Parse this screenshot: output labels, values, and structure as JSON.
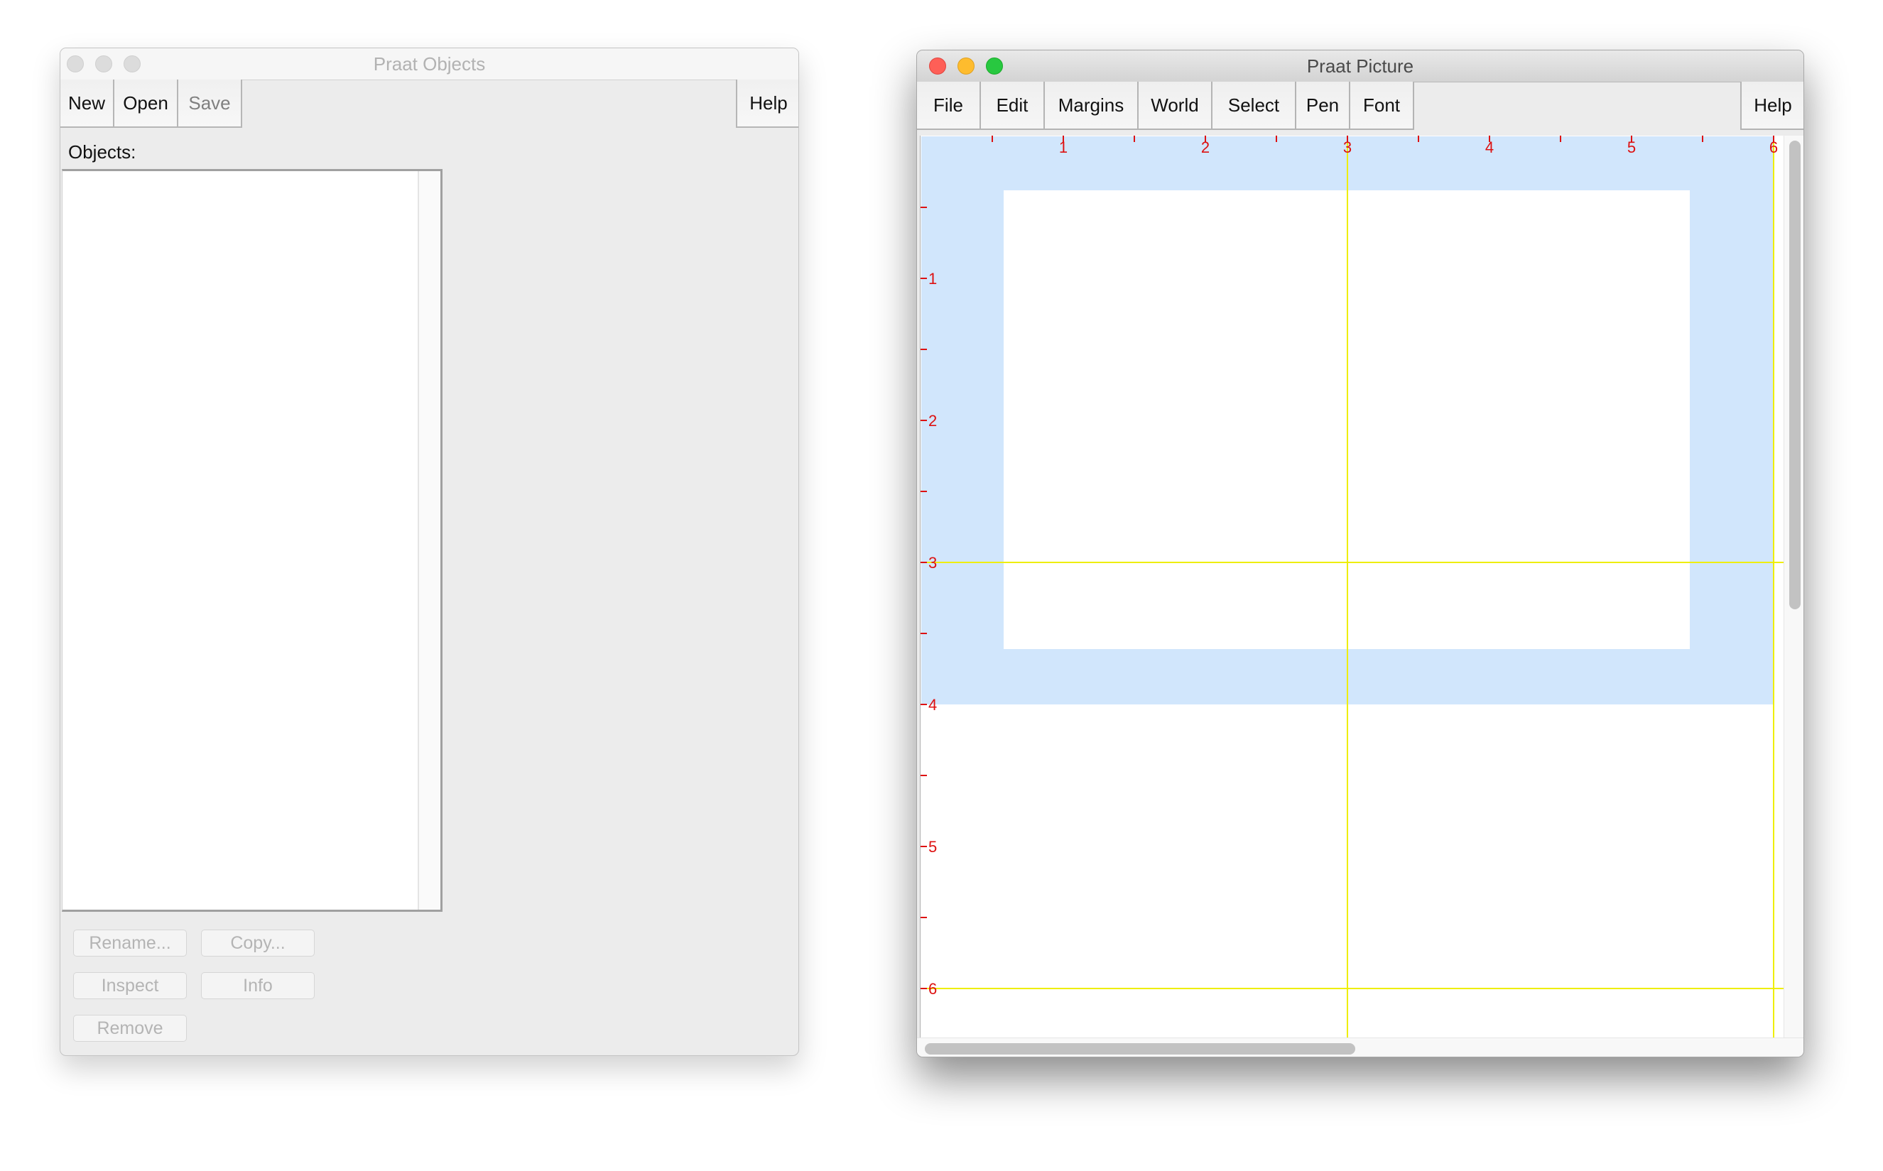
{
  "objects_window": {
    "title": "Praat Objects",
    "active": false,
    "toolbar": [
      {
        "label": "New",
        "enabled": true
      },
      {
        "label": "Open",
        "enabled": true
      },
      {
        "label": "Save",
        "enabled": false
      }
    ],
    "help_label": "Help",
    "list_label": "Objects:",
    "list_items": [],
    "actions": [
      {
        "label": "Rename...",
        "enabled": false
      },
      {
        "label": "Copy...",
        "enabled": false
      },
      {
        "label": "Inspect",
        "enabled": false
      },
      {
        "label": "Info",
        "enabled": false
      },
      {
        "label": "Remove",
        "enabled": false
      }
    ]
  },
  "picture_window": {
    "title": "Praat Picture",
    "active": true,
    "menus": [
      {
        "label": "File"
      },
      {
        "label": "Edit"
      },
      {
        "label": "Margins"
      },
      {
        "label": "World"
      },
      {
        "label": "Select"
      },
      {
        "label": "Pen"
      },
      {
        "label": "Font"
      }
    ],
    "help_label": "Help",
    "canvas": {
      "units": "inches",
      "horizontal_ruler_labels": [
        "1",
        "2",
        "3",
        "4",
        "5",
        "6"
      ],
      "vertical_ruler_labels": [
        "1",
        "2",
        "3",
        "4",
        "5",
        "6"
      ],
      "tick_interval": 0.5,
      "viewport_selection": {
        "x": [
          0,
          6
        ],
        "y": [
          0,
          4
        ]
      },
      "inner_viewport": {
        "x": [
          0.58,
          5.41
        ],
        "y": [
          0.38,
          3.61
        ]
      },
      "guide_lines_x": [
        3,
        6
      ],
      "guide_lines_y": [
        3,
        6
      ]
    },
    "colors": {
      "selection": "#d1e6fc",
      "ruler": "#dd1111",
      "guide": "#eeee00"
    }
  }
}
